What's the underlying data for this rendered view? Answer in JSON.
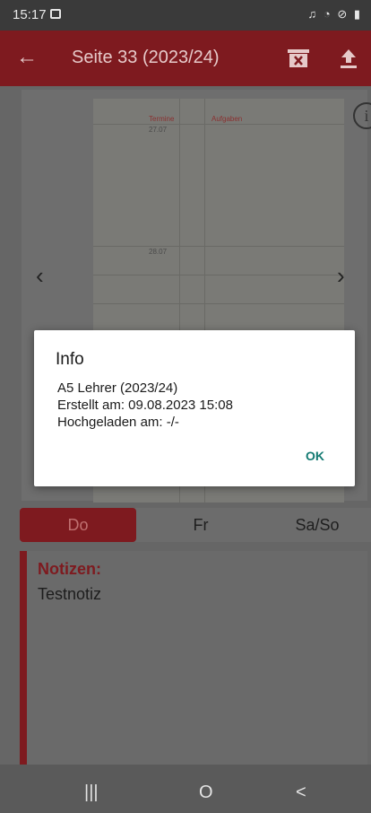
{
  "status_bar": {
    "time": "15:17",
    "icons": [
      "image-icon",
      "mute-icon",
      "wifi-icon",
      "dnd-icon",
      "battery-icon"
    ]
  },
  "app_bar": {
    "title": "Seite 33 (2023/24)",
    "icons": [
      "back-arrow-icon",
      "delete-box-icon",
      "upload-icon"
    ]
  },
  "page_preview": {
    "col_left_label": "Termine",
    "col_right_label": "Aufgaben",
    "dates": [
      "27.07",
      "28.07"
    ],
    "icons": [
      "info-icon",
      "chevron-left-icon",
      "chevron-right-icon"
    ]
  },
  "day_tabs": [
    {
      "label": "Do",
      "active": true
    },
    {
      "label": "Fr",
      "active": false
    },
    {
      "label": "Sa/So",
      "active": false
    }
  ],
  "notes": {
    "label": "Notizen:",
    "text": "Testnotiz"
  },
  "dialog": {
    "title": "Info",
    "lines": [
      "A5 Lehrer (2023/24)",
      "Erstellt am: 09.08.2023 15:08",
      "Hochgeladen am: -/-"
    ],
    "ok_label": "OK"
  },
  "nav_bar": {
    "recents": "|||",
    "home": "O",
    "back": "<"
  },
  "colors": {
    "brand": "#b0202a",
    "dialog_button": "#137a72"
  }
}
